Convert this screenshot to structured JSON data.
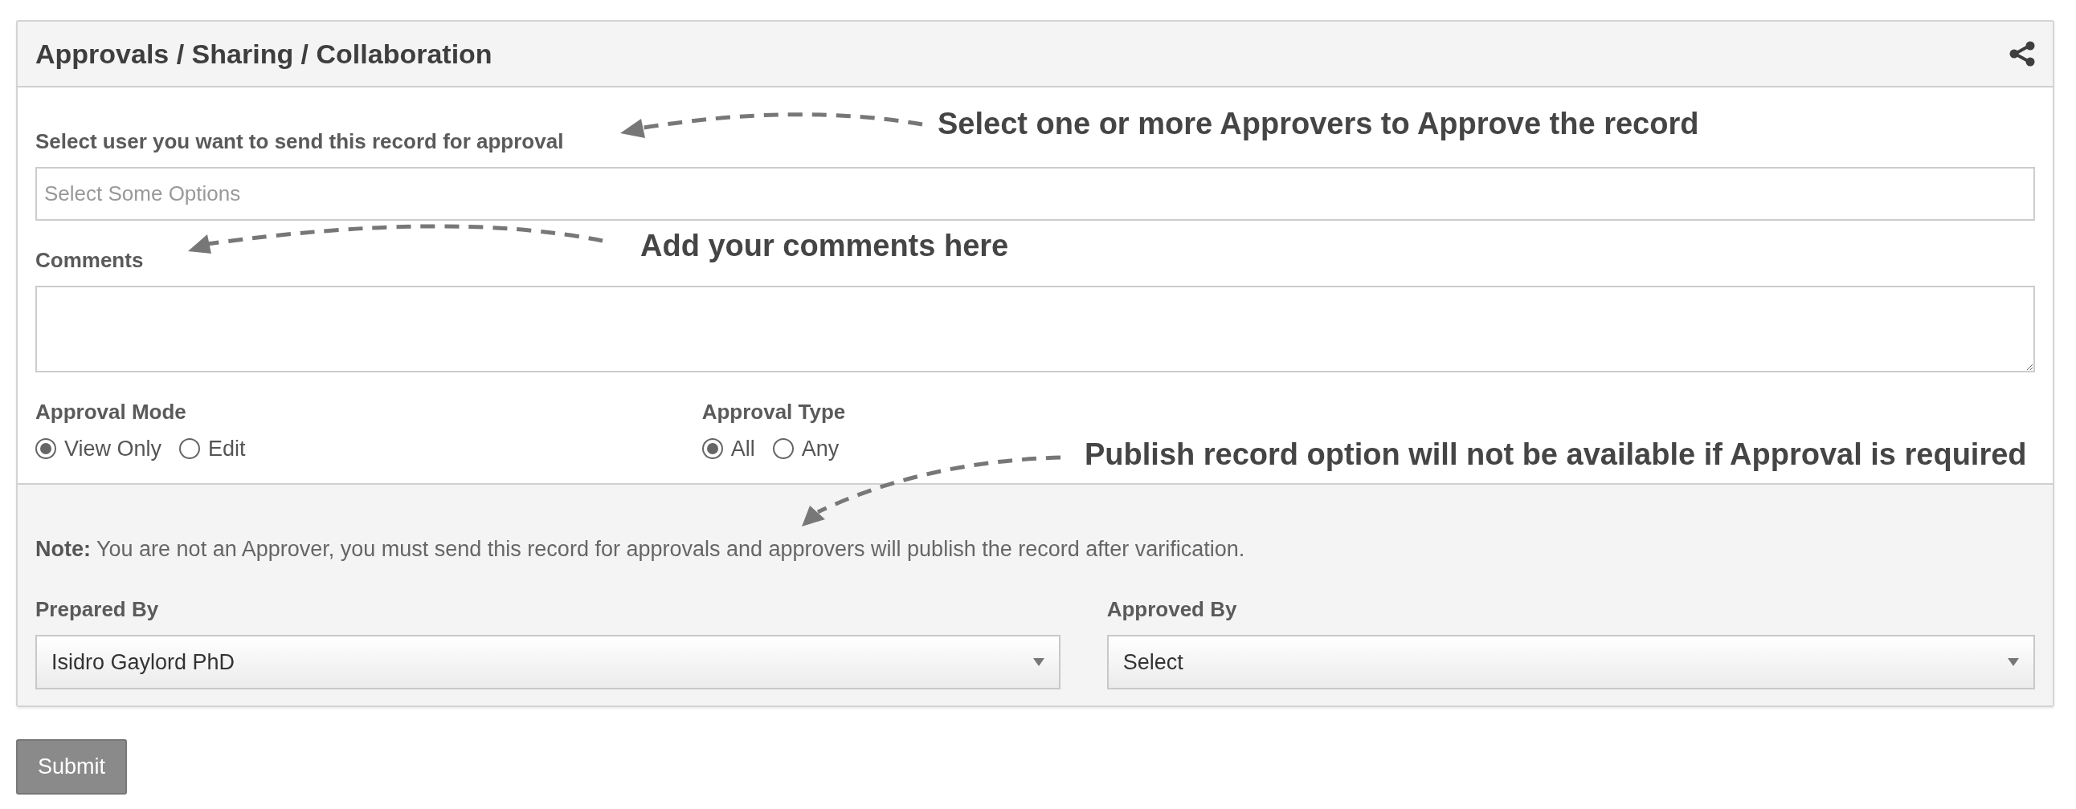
{
  "panel": {
    "title": "Approvals / Sharing / Collaboration"
  },
  "approvers": {
    "label": "Select user you want to send this record for approval",
    "placeholder": "Select Some Options"
  },
  "comments": {
    "label": "Comments"
  },
  "approval_mode": {
    "label": "Approval Mode",
    "options": [
      {
        "label": "View Only",
        "selected": true
      },
      {
        "label": "Edit",
        "selected": false
      }
    ]
  },
  "approval_type": {
    "label": "Approval Type",
    "options": [
      {
        "label": "All",
        "selected": true
      },
      {
        "label": "Any",
        "selected": false
      }
    ]
  },
  "note": "**Note:** You are not an Approver, you must send this record for approvals and approvers will publish the record after varification.",
  "prepared_by": {
    "label": "Prepared By",
    "value": "Isidro Gaylord PhD"
  },
  "approved_by": {
    "label": "Approved By",
    "value": "Select"
  },
  "submit": "Submit",
  "annotations": [
    {
      "text": "Select one or more Approvers to Approve the record"
    },
    {
      "text": "Add your comments here"
    },
    {
      "text": "Publish record option will not be available if Approval is required"
    }
  ]
}
